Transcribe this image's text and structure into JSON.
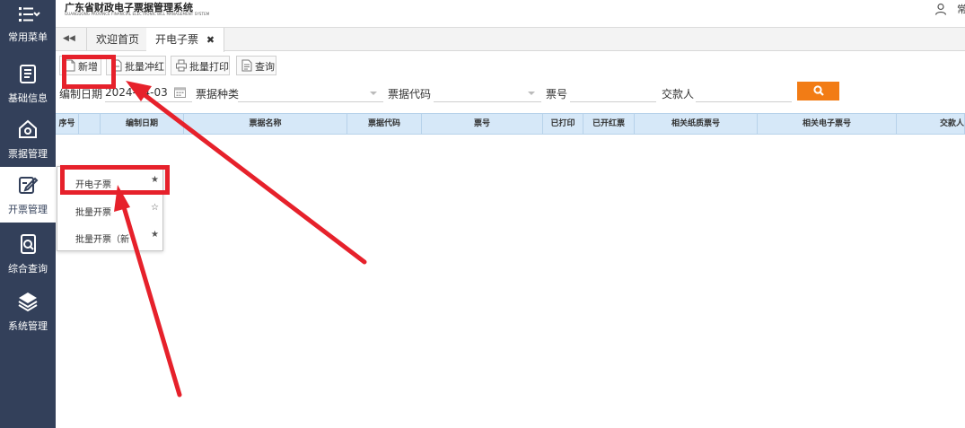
{
  "app": {
    "title": "广东省财政电子票据管理系统",
    "subtitle": "GUANGDONG PROVINCE FINANCIAL ELECTRONIC BILL MANAGEMENT SYSTEM",
    "user_name": "常"
  },
  "sidebar": {
    "items": [
      {
        "label": "常用菜单",
        "icon": "menu-list-icon"
      },
      {
        "label": "基础信息",
        "icon": "info-book-icon"
      },
      {
        "label": "票据管理",
        "icon": "home-gear-icon"
      },
      {
        "label": "开票管理",
        "icon": "edit-invoice-icon",
        "active": true
      },
      {
        "label": "综合查询",
        "icon": "search-document-icon"
      },
      {
        "label": "系统管理",
        "icon": "layers-icon"
      }
    ]
  },
  "tabs": [
    {
      "label": "欢迎首页"
    },
    {
      "label": "开电子票",
      "active": true,
      "close": "✖"
    }
  ],
  "tab_back_glyph": "◀◀",
  "toolbar": {
    "add": "新增",
    "red_flush": "批量冲红",
    "batch_print": "批量打印",
    "query": "查询"
  },
  "filters": {
    "date_label": "编制日期",
    "date_value": "2024-04-03",
    "bill_type_label": "票据种类",
    "bill_code_label": "票据代码",
    "bill_no_label": "票号",
    "payer_label": "交款人"
  },
  "table": {
    "columns": [
      "序号",
      "",
      "编制日期",
      "票据名称",
      "票据代码",
      "票号",
      "已打印",
      "已开红票",
      "相关纸质票号",
      "相关电子票号",
      "交款人"
    ]
  },
  "dropdown": {
    "items": [
      {
        "label": "开电子票",
        "star": "★"
      },
      {
        "label": "批量开票",
        "star": "☆"
      },
      {
        "label": "批量开票（新",
        "star": "★"
      }
    ]
  },
  "colors": {
    "sidebar_bg": "#33405a",
    "table_header_bg": "#d6e8f8",
    "search_button": "#f27c15",
    "annotation_red": "#e6212b"
  }
}
